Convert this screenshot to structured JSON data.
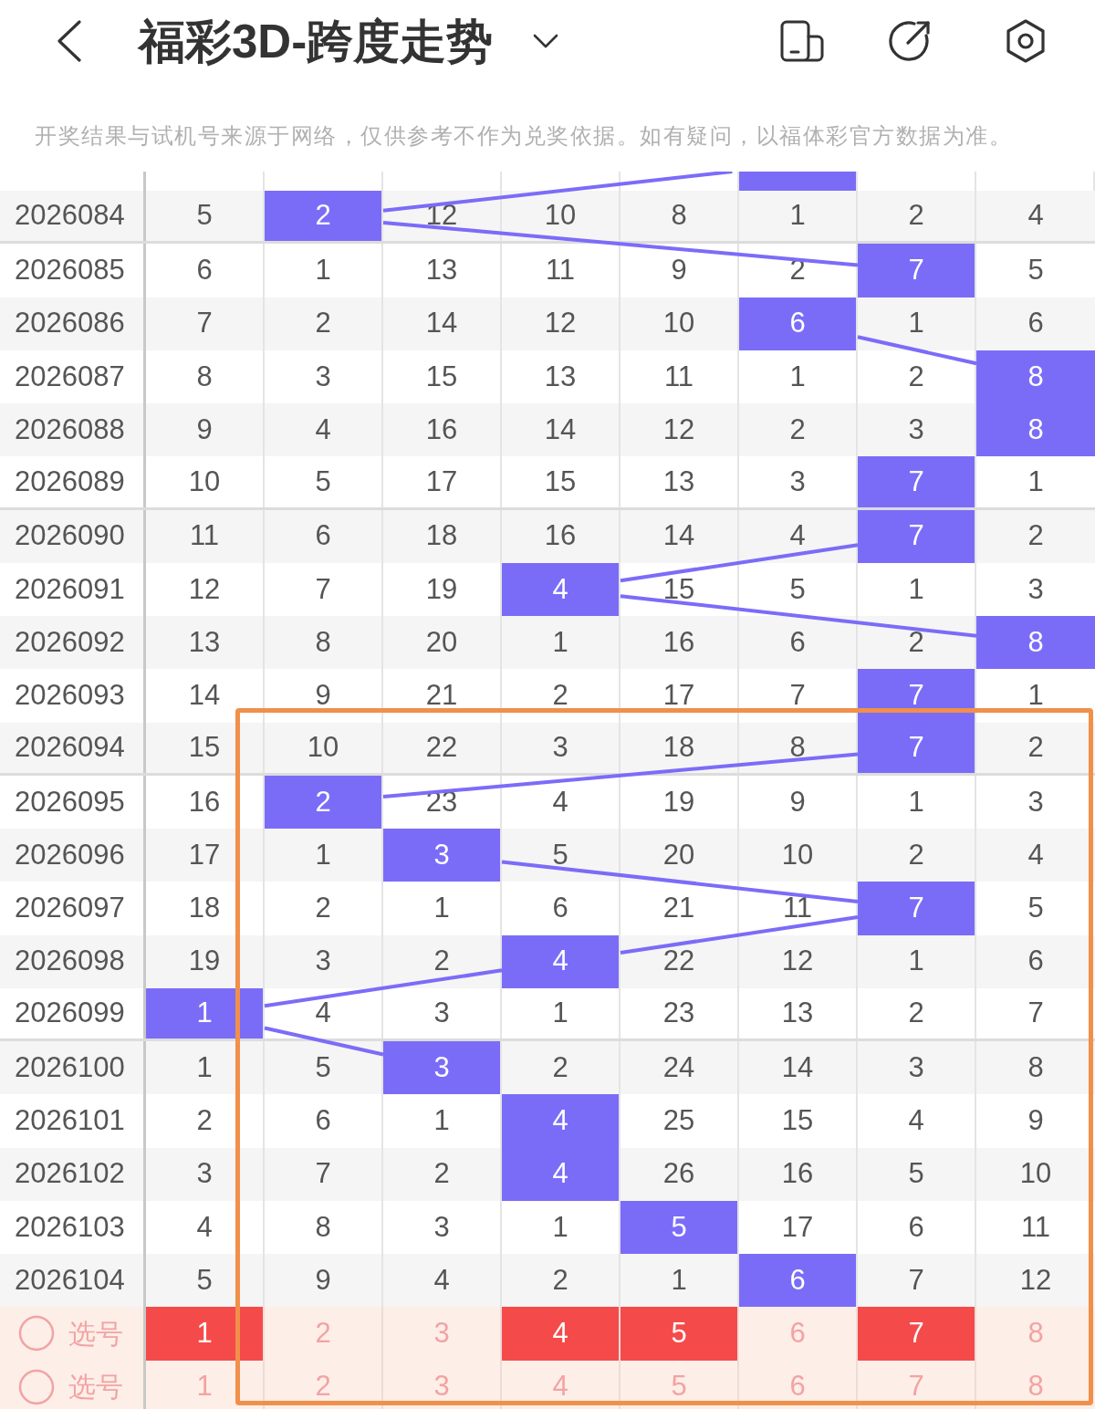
{
  "header": {
    "title": "福彩3D-跨度走势"
  },
  "notice": "开奖结果与试机号来源于网络，仅供参考不作为兑奖依据。如有疑问，以福体彩官方数据为准。",
  "cut_row": {
    "cells": [
      {
        "hit": false
      },
      {
        "hit": false
      },
      {
        "hit": false
      },
      {
        "hit": false
      },
      {
        "hit": false
      },
      {
        "hit": true
      },
      {
        "hit": false
      },
      {
        "hit": false
      }
    ]
  },
  "rows": [
    {
      "period": "2026084",
      "cells": [
        {
          "text": "5",
          "hit": false
        },
        {
          "text": "2",
          "hit": true
        },
        {
          "text": "12",
          "hit": false
        },
        {
          "text": "10",
          "hit": false
        },
        {
          "text": "8",
          "hit": false
        },
        {
          "text": "1",
          "hit": false
        },
        {
          "text": "2",
          "hit": false
        },
        {
          "text": "4",
          "hit": false
        }
      ]
    },
    {
      "period": "2026085",
      "cells": [
        {
          "text": "6",
          "hit": false
        },
        {
          "text": "1",
          "hit": false
        },
        {
          "text": "13",
          "hit": false
        },
        {
          "text": "11",
          "hit": false
        },
        {
          "text": "9",
          "hit": false
        },
        {
          "text": "2",
          "hit": false
        },
        {
          "text": "7",
          "hit": true
        },
        {
          "text": "5",
          "hit": false
        }
      ]
    },
    {
      "period": "2026086",
      "cells": [
        {
          "text": "7",
          "hit": false
        },
        {
          "text": "2",
          "hit": false
        },
        {
          "text": "14",
          "hit": false
        },
        {
          "text": "12",
          "hit": false
        },
        {
          "text": "10",
          "hit": false
        },
        {
          "text": "6",
          "hit": true
        },
        {
          "text": "1",
          "hit": false
        },
        {
          "text": "6",
          "hit": false
        }
      ]
    },
    {
      "period": "2026087",
      "cells": [
        {
          "text": "8",
          "hit": false
        },
        {
          "text": "3",
          "hit": false
        },
        {
          "text": "15",
          "hit": false
        },
        {
          "text": "13",
          "hit": false
        },
        {
          "text": "11",
          "hit": false
        },
        {
          "text": "1",
          "hit": false
        },
        {
          "text": "2",
          "hit": false
        },
        {
          "text": "8",
          "hit": true
        }
      ]
    },
    {
      "period": "2026088",
      "cells": [
        {
          "text": "9",
          "hit": false
        },
        {
          "text": "4",
          "hit": false
        },
        {
          "text": "16",
          "hit": false
        },
        {
          "text": "14",
          "hit": false
        },
        {
          "text": "12",
          "hit": false
        },
        {
          "text": "2",
          "hit": false
        },
        {
          "text": "3",
          "hit": false
        },
        {
          "text": "8",
          "hit": true
        }
      ]
    },
    {
      "period": "2026089",
      "cells": [
        {
          "text": "10",
          "hit": false
        },
        {
          "text": "5",
          "hit": false
        },
        {
          "text": "17",
          "hit": false
        },
        {
          "text": "15",
          "hit": false
        },
        {
          "text": "13",
          "hit": false
        },
        {
          "text": "3",
          "hit": false
        },
        {
          "text": "7",
          "hit": true
        },
        {
          "text": "1",
          "hit": false
        }
      ]
    },
    {
      "period": "2026090",
      "cells": [
        {
          "text": "11",
          "hit": false
        },
        {
          "text": "6",
          "hit": false
        },
        {
          "text": "18",
          "hit": false
        },
        {
          "text": "16",
          "hit": false
        },
        {
          "text": "14",
          "hit": false
        },
        {
          "text": "4",
          "hit": false
        },
        {
          "text": "7",
          "hit": true
        },
        {
          "text": "2",
          "hit": false
        }
      ]
    },
    {
      "period": "2026091",
      "cells": [
        {
          "text": "12",
          "hit": false
        },
        {
          "text": "7",
          "hit": false
        },
        {
          "text": "19",
          "hit": false
        },
        {
          "text": "4",
          "hit": true
        },
        {
          "text": "15",
          "hit": false
        },
        {
          "text": "5",
          "hit": false
        },
        {
          "text": "1",
          "hit": false
        },
        {
          "text": "3",
          "hit": false
        }
      ]
    },
    {
      "period": "2026092",
      "cells": [
        {
          "text": "13",
          "hit": false
        },
        {
          "text": "8",
          "hit": false
        },
        {
          "text": "20",
          "hit": false
        },
        {
          "text": "1",
          "hit": false
        },
        {
          "text": "16",
          "hit": false
        },
        {
          "text": "6",
          "hit": false
        },
        {
          "text": "2",
          "hit": false
        },
        {
          "text": "8",
          "hit": true
        }
      ]
    },
    {
      "period": "2026093",
      "cells": [
        {
          "text": "14",
          "hit": false
        },
        {
          "text": "9",
          "hit": false
        },
        {
          "text": "21",
          "hit": false
        },
        {
          "text": "2",
          "hit": false
        },
        {
          "text": "17",
          "hit": false
        },
        {
          "text": "7",
          "hit": false
        },
        {
          "text": "7",
          "hit": true
        },
        {
          "text": "1",
          "hit": false
        }
      ]
    },
    {
      "period": "2026094",
      "cells": [
        {
          "text": "15",
          "hit": false
        },
        {
          "text": "10",
          "hit": false
        },
        {
          "text": "22",
          "hit": false
        },
        {
          "text": "3",
          "hit": false
        },
        {
          "text": "18",
          "hit": false
        },
        {
          "text": "8",
          "hit": false
        },
        {
          "text": "7",
          "hit": true
        },
        {
          "text": "2",
          "hit": false
        }
      ]
    },
    {
      "period": "2026095",
      "cells": [
        {
          "text": "16",
          "hit": false
        },
        {
          "text": "2",
          "hit": true
        },
        {
          "text": "23",
          "hit": false
        },
        {
          "text": "4",
          "hit": false
        },
        {
          "text": "19",
          "hit": false
        },
        {
          "text": "9",
          "hit": false
        },
        {
          "text": "1",
          "hit": false
        },
        {
          "text": "3",
          "hit": false
        }
      ]
    },
    {
      "period": "2026096",
      "cells": [
        {
          "text": "17",
          "hit": false
        },
        {
          "text": "1",
          "hit": false
        },
        {
          "text": "3",
          "hit": true
        },
        {
          "text": "5",
          "hit": false
        },
        {
          "text": "20",
          "hit": false
        },
        {
          "text": "10",
          "hit": false
        },
        {
          "text": "2",
          "hit": false
        },
        {
          "text": "4",
          "hit": false
        }
      ]
    },
    {
      "period": "2026097",
      "cells": [
        {
          "text": "18",
          "hit": false
        },
        {
          "text": "2",
          "hit": false
        },
        {
          "text": "1",
          "hit": false
        },
        {
          "text": "6",
          "hit": false
        },
        {
          "text": "21",
          "hit": false
        },
        {
          "text": "11",
          "hit": false
        },
        {
          "text": "7",
          "hit": true
        },
        {
          "text": "5",
          "hit": false
        }
      ]
    },
    {
      "period": "2026098",
      "cells": [
        {
          "text": "19",
          "hit": false
        },
        {
          "text": "3",
          "hit": false
        },
        {
          "text": "2",
          "hit": false
        },
        {
          "text": "4",
          "hit": true
        },
        {
          "text": "22",
          "hit": false
        },
        {
          "text": "12",
          "hit": false
        },
        {
          "text": "1",
          "hit": false
        },
        {
          "text": "6",
          "hit": false
        }
      ]
    },
    {
      "period": "2026099",
      "cells": [
        {
          "text": "1",
          "hit": true
        },
        {
          "text": "4",
          "hit": false
        },
        {
          "text": "3",
          "hit": false
        },
        {
          "text": "1",
          "hit": false
        },
        {
          "text": "23",
          "hit": false
        },
        {
          "text": "13",
          "hit": false
        },
        {
          "text": "2",
          "hit": false
        },
        {
          "text": "7",
          "hit": false
        }
      ]
    },
    {
      "period": "2026100",
      "cells": [
        {
          "text": "1",
          "hit": false
        },
        {
          "text": "5",
          "hit": false
        },
        {
          "text": "3",
          "hit": true
        },
        {
          "text": "2",
          "hit": false
        },
        {
          "text": "24",
          "hit": false
        },
        {
          "text": "14",
          "hit": false
        },
        {
          "text": "3",
          "hit": false
        },
        {
          "text": "8",
          "hit": false
        }
      ]
    },
    {
      "period": "2026101",
      "cells": [
        {
          "text": "2",
          "hit": false
        },
        {
          "text": "6",
          "hit": false
        },
        {
          "text": "1",
          "hit": false
        },
        {
          "text": "4",
          "hit": true
        },
        {
          "text": "25",
          "hit": false
        },
        {
          "text": "15",
          "hit": false
        },
        {
          "text": "4",
          "hit": false
        },
        {
          "text": "9",
          "hit": false
        }
      ]
    },
    {
      "period": "2026102",
      "cells": [
        {
          "text": "3",
          "hit": false
        },
        {
          "text": "7",
          "hit": false
        },
        {
          "text": "2",
          "hit": false
        },
        {
          "text": "4",
          "hit": true
        },
        {
          "text": "26",
          "hit": false
        },
        {
          "text": "16",
          "hit": false
        },
        {
          "text": "5",
          "hit": false
        },
        {
          "text": "10",
          "hit": false
        }
      ]
    },
    {
      "period": "2026103",
      "cells": [
        {
          "text": "4",
          "hit": false
        },
        {
          "text": "8",
          "hit": false
        },
        {
          "text": "3",
          "hit": false
        },
        {
          "text": "1",
          "hit": false
        },
        {
          "text": "5",
          "hit": true
        },
        {
          "text": "17",
          "hit": false
        },
        {
          "text": "6",
          "hit": false
        },
        {
          "text": "11",
          "hit": false
        }
      ]
    },
    {
      "period": "2026104",
      "cells": [
        {
          "text": "5",
          "hit": false
        },
        {
          "text": "9",
          "hit": false
        },
        {
          "text": "4",
          "hit": false
        },
        {
          "text": "2",
          "hit": false
        },
        {
          "text": "1",
          "hit": false
        },
        {
          "text": "6",
          "hit": true
        },
        {
          "text": "7",
          "hit": false
        },
        {
          "text": "12",
          "hit": false
        }
      ]
    }
  ],
  "pick_rows": [
    {
      "label": "选号",
      "checked": false,
      "balls": [
        {
          "text": "1",
          "selected": true
        },
        {
          "text": "2",
          "selected": false
        },
        {
          "text": "3",
          "selected": false
        },
        {
          "text": "4",
          "selected": true
        },
        {
          "text": "5",
          "selected": true
        },
        {
          "text": "6",
          "selected": false
        },
        {
          "text": "7",
          "selected": true
        },
        {
          "text": "8",
          "selected": false
        }
      ]
    },
    {
      "label": "选号",
      "checked": false,
      "balls": [
        {
          "text": "1",
          "selected": false
        },
        {
          "text": "2",
          "selected": false
        },
        {
          "text": "3",
          "selected": false
        },
        {
          "text": "4",
          "selected": false
        },
        {
          "text": "5",
          "selected": false
        },
        {
          "text": "6",
          "selected": false
        },
        {
          "text": "7",
          "selected": false
        },
        {
          "text": "8",
          "selected": false
        }
      ]
    }
  ],
  "annotation_frame": true
}
